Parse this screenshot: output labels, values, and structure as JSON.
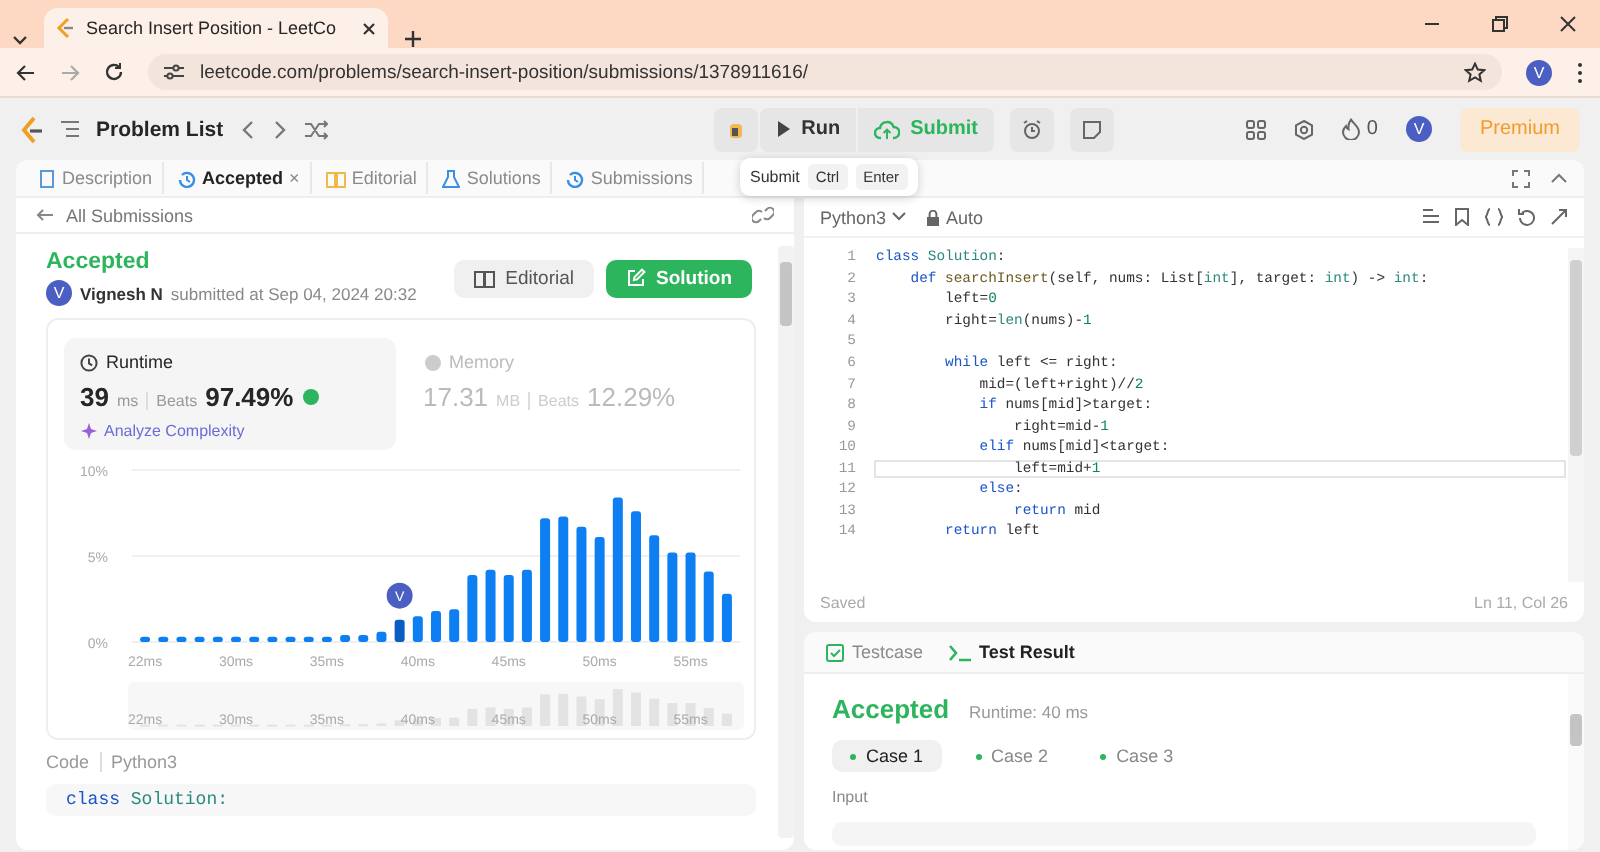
{
  "browser": {
    "tab_title": "Search Insert Position - LeetCo",
    "url": "leetcode.com/problems/search-insert-position/submissions/1378911616/",
    "profile_initial": "V"
  },
  "nav": {
    "problem_list": "Problem List",
    "run": "Run",
    "submit": "Submit",
    "streak": "0",
    "avatar_initial": "V",
    "premium": "Premium"
  },
  "tooltip": {
    "label": "Submit",
    "keys": [
      "Ctrl",
      "Enter"
    ]
  },
  "left_panel": {
    "tabs": [
      {
        "label": "Description",
        "kind": "description",
        "selected": false
      },
      {
        "label": "Accepted",
        "kind": "history",
        "selected": true,
        "close": "×"
      },
      {
        "label": "Editorial",
        "kind": "editorial",
        "selected": false
      },
      {
        "label": "Solutions",
        "kind": "solutions",
        "selected": false
      },
      {
        "label": "Submissions",
        "kind": "history",
        "selected": false
      }
    ],
    "back_link": "All Submissions",
    "submission": {
      "status": "Accepted",
      "avatar_initial": "V",
      "user": "Vignesh N",
      "submitted_at": "submitted at Sep 04, 2024 20:32",
      "editorial_button": "Editorial",
      "solution_button": "Solution"
    },
    "stats": [
      {
        "kind": "runtime",
        "label": "Runtime",
        "value": "39",
        "unit": "ms",
        "beats_label": "Beats",
        "beats": "97.49%",
        "selected": true,
        "link": "Analyze Complexity"
      },
      {
        "kind": "memory",
        "label": "Memory",
        "value": "17.31",
        "unit": "MB",
        "beats_label": "Beats",
        "beats": "12.29%",
        "selected": false
      }
    ],
    "chart_data": {
      "type": "bar",
      "yticks": [
        {
          "value": 0,
          "label": "0%"
        },
        {
          "value": 5,
          "label": "5%"
        },
        {
          "value": 10,
          "label": "10%"
        }
      ],
      "ylim": [
        0,
        10
      ],
      "categories": [
        "22ms",
        null,
        null,
        null,
        null,
        "30ms",
        null,
        null,
        null,
        null,
        "35ms",
        null,
        null,
        null,
        null,
        "40ms",
        null,
        null,
        null,
        null,
        "45ms",
        null,
        null,
        null,
        null,
        "50ms",
        null,
        null,
        null,
        null,
        "55ms",
        null,
        null
      ],
      "values": [
        0.3,
        0.3,
        0.3,
        0.3,
        0.3,
        0.3,
        0.3,
        0.3,
        0.3,
        0.3,
        0.3,
        0.4,
        0.4,
        0.6,
        1.3,
        1.5,
        1.8,
        1.9,
        3.9,
        4.2,
        3.9,
        4.2,
        7.2,
        7.3,
        6.7,
        6.1,
        8.4,
        7.6,
        6.2,
        5.2,
        5.2,
        4.1,
        2.8
      ]
    },
    "user_marker": {
      "initial": "V",
      "on_bar": [
        false,
        false,
        false,
        false,
        false,
        false,
        false,
        false,
        false,
        false,
        false,
        false,
        false,
        false,
        true,
        false,
        false,
        false,
        false,
        false,
        false,
        false,
        false,
        false,
        false,
        false,
        false,
        false,
        false,
        false,
        false,
        false,
        false
      ]
    },
    "overview_labels": [
      "22ms",
      "30ms",
      "35ms",
      "40ms",
      "45ms",
      "50ms",
      "55ms"
    ],
    "code_label": "Code",
    "code_language": "Python3",
    "code_preview": [
      {
        "text": "class ",
        "kind": "keyword"
      },
      {
        "text": "Solution:",
        "kind": "class"
      }
    ]
  },
  "editor": {
    "language": "Python3",
    "mode": "Auto",
    "lines": [
      {
        "number": "1",
        "current": false,
        "tokens": [
          {
            "text": "class ",
            "kind": "keyword"
          },
          {
            "text": "Solution",
            "kind": "class"
          },
          {
            "text": ":",
            "kind": "plain"
          }
        ]
      },
      {
        "number": "2",
        "current": false,
        "tokens": [
          {
            "text": "    def ",
            "kind": "keyword"
          },
          {
            "text": "searchInsert",
            "kind": "function"
          },
          {
            "text": "(self, nums: List[",
            "kind": "plain"
          },
          {
            "text": "int",
            "kind": "type"
          },
          {
            "text": "], target: ",
            "kind": "plain"
          },
          {
            "text": "int",
            "kind": "type"
          },
          {
            "text": ") -> ",
            "kind": "plain"
          },
          {
            "text": "int",
            "kind": "type"
          },
          {
            "text": ":",
            "kind": "plain"
          }
        ]
      },
      {
        "number": "3",
        "current": false,
        "tokens": [
          {
            "text": "        left=",
            "kind": "plain"
          },
          {
            "text": "0",
            "kind": "number"
          }
        ]
      },
      {
        "number": "4",
        "current": false,
        "tokens": [
          {
            "text": "        right=",
            "kind": "plain"
          },
          {
            "text": "len",
            "kind": "type"
          },
          {
            "text": "(nums)-",
            "kind": "plain"
          },
          {
            "text": "1",
            "kind": "number"
          }
        ]
      },
      {
        "number": "5",
        "current": false
      },
      {
        "number": "6",
        "current": false,
        "tokens": [
          {
            "text": "        while",
            "kind": "keyword"
          },
          {
            "text": " left <= right:",
            "kind": "plain"
          }
        ]
      },
      {
        "number": "7",
        "current": false,
        "tokens": [
          {
            "text": "            mid=(left+right)//",
            "kind": "plain"
          },
          {
            "text": "2",
            "kind": "number"
          }
        ]
      },
      {
        "number": "8",
        "current": false,
        "tokens": [
          {
            "text": "            if",
            "kind": "keyword"
          },
          {
            "text": " nums[mid]>target:",
            "kind": "plain"
          }
        ]
      },
      {
        "number": "9",
        "current": false,
        "tokens": [
          {
            "text": "                right=mid-",
            "kind": "plain"
          },
          {
            "text": "1",
            "kind": "number"
          }
        ]
      },
      {
        "number": "10",
        "current": false,
        "tokens": [
          {
            "text": "            elif",
            "kind": "keyword"
          },
          {
            "text": " nums[mid]<target:",
            "kind": "plain"
          }
        ]
      },
      {
        "number": "11",
        "current": true,
        "tokens": [
          {
            "text": "                left=mid+",
            "kind": "plain"
          },
          {
            "text": "1",
            "kind": "number"
          }
        ]
      },
      {
        "number": "12",
        "current": false,
        "tokens": [
          {
            "text": "            else",
            "kind": "keyword"
          },
          {
            "text": ":",
            "kind": "plain"
          }
        ]
      },
      {
        "number": "13",
        "current": false,
        "tokens": [
          {
            "text": "                return",
            "kind": "keyword"
          },
          {
            "text": " mid",
            "kind": "plain"
          }
        ]
      },
      {
        "number": "14",
        "current": false,
        "tokens": [
          {
            "text": "        return",
            "kind": "keyword"
          },
          {
            "text": " left",
            "kind": "plain"
          }
        ]
      }
    ],
    "status": "Saved",
    "cursor": "Ln 11, Col 26"
  },
  "test_panel": {
    "tabs": [
      {
        "label": "Testcase",
        "kind": "testcase",
        "selected": false
      },
      {
        "label": "Test Result",
        "kind": "result",
        "selected": true
      }
    ],
    "status": "Accepted",
    "runtime": "Runtime: 40 ms",
    "cases": [
      {
        "label": "Case 1",
        "selected": true
      },
      {
        "label": "Case 2",
        "selected": false
      },
      {
        "label": "Case 3",
        "selected": false
      }
    ],
    "input_label": "Input"
  }
}
